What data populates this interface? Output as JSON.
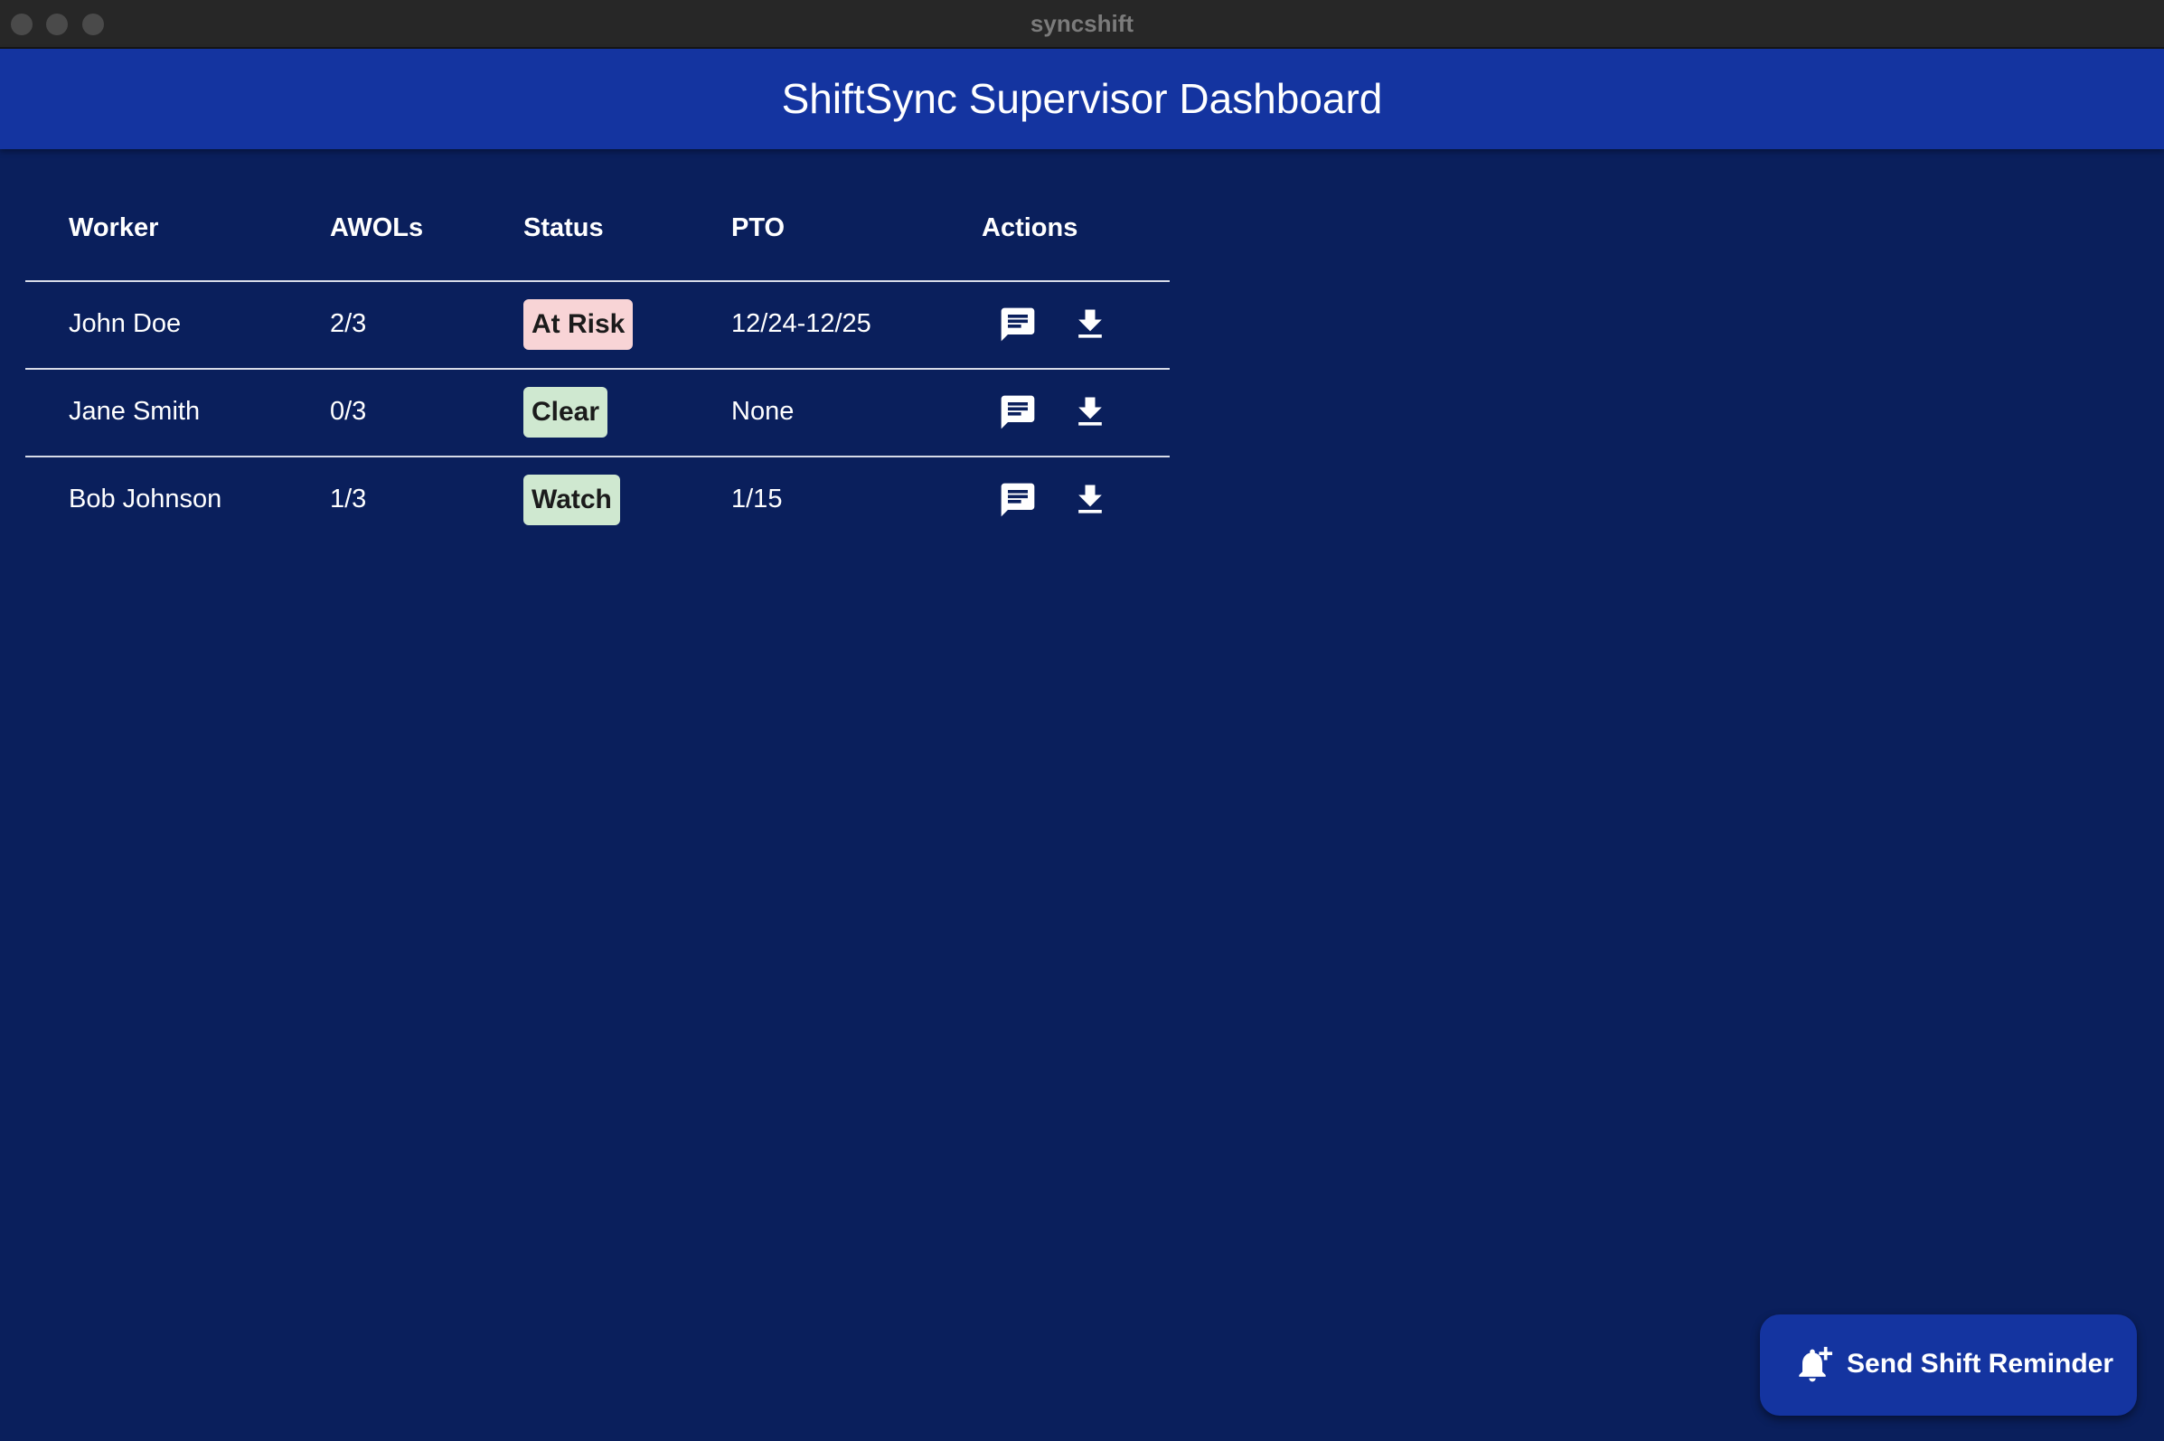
{
  "window": {
    "title": "syncshift"
  },
  "app": {
    "title": "ShiftSync Supervisor Dashboard"
  },
  "table": {
    "headers": {
      "worker": "Worker",
      "awols": "AWOLs",
      "status": "Status",
      "pto": "PTO",
      "actions": "Actions"
    },
    "rows": [
      {
        "worker": "John Doe",
        "awols": "2/3",
        "status": "At Risk",
        "status_color": "#f8d4d6",
        "pto": "12/24-12/25"
      },
      {
        "worker": "Jane Smith",
        "awols": "0/3",
        "status": "Clear",
        "status_color": "#cfe8d0",
        "pto": "None"
      },
      {
        "worker": "Bob Johnson",
        "awols": "1/3",
        "status": "Watch",
        "status_color": "#cfe8d0",
        "pto": "1/15"
      }
    ],
    "action_icons": [
      "message-icon",
      "download-icon"
    ]
  },
  "fab": {
    "label": "Send Shift Reminder",
    "icon": "bell-plus-icon"
  },
  "colors": {
    "background": "#0a1f5c",
    "appbar": "#1434a0",
    "titlebar": "#272727"
  }
}
